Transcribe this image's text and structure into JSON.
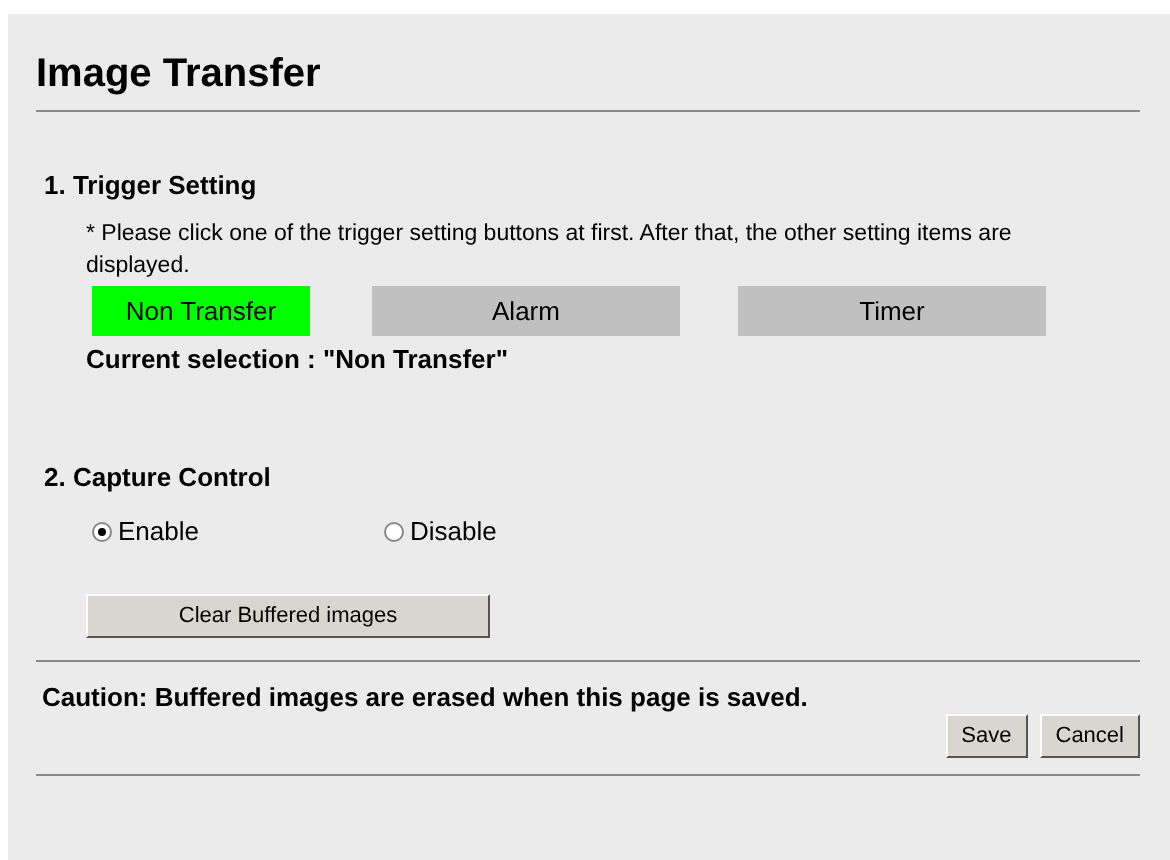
{
  "title": "Image Transfer",
  "trigger": {
    "heading": "1.  Trigger Setting",
    "note": "* Please click one of the trigger setting buttons at first. After that, the other setting items are displayed.",
    "buttons": [
      {
        "label": "Non Transfer",
        "selected": true
      },
      {
        "label": "Alarm",
        "selected": false
      },
      {
        "label": "Timer",
        "selected": false
      }
    ],
    "current": "Current selection : \"Non Transfer\""
  },
  "capture": {
    "heading": "2.  Capture Control",
    "options": [
      {
        "label": "Enable",
        "selected": true
      },
      {
        "label": "Disable",
        "selected": false
      }
    ],
    "clear_button": "Clear Buffered images"
  },
  "caution": "Caution: Buffered images are erased when this page is saved.",
  "buttons": [
    "Save",
    "Cancel"
  ]
}
